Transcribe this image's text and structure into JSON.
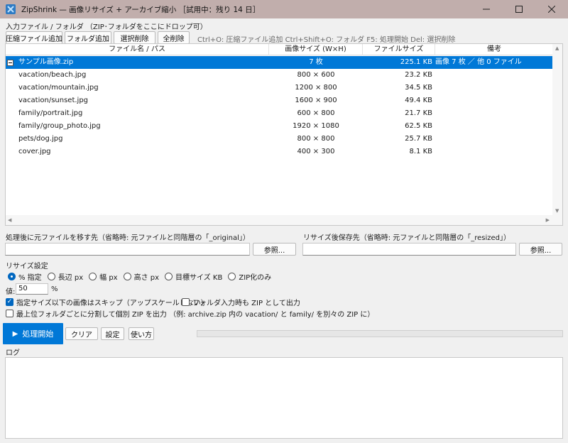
{
  "window": {
    "title": "ZipShrink  —  画像リサイズ + アーカイブ縮小  ［試用中：残り 14 日］",
    "controls": {
      "minimize": "–",
      "maximize": "□",
      "close": "✕"
    }
  },
  "input_section": {
    "label": "入力ファイル / フォルダ （ZIP･フォルダをここにドロップ可）",
    "buttons": {
      "add_archive": "圧縮ファイル追加",
      "add_folder": "フォルダ追加",
      "remove_selected": "選択削除",
      "remove_all": "全削除"
    },
    "shortcuts_hint": "Ctrl+O: 圧縮ファイル追加  Ctrl+Shift+O: フォルダ  F5: 処理開始  Del: 選択削除"
  },
  "file_table": {
    "columns": {
      "name": "ファイル名 / パス",
      "dimensions": "画像サイズ (W×H)",
      "filesize": "ファイルサイズ",
      "note": "備考"
    },
    "rows": [
      {
        "name": "サンプル画像.zip",
        "dimensions": "7 枚",
        "filesize": "225.1 KB",
        "note": "画像 7 枚 ／ 他 0 ファイル"
      },
      {
        "name": "vacation/beach.jpg",
        "dimensions": "800 × 600",
        "filesize": "23.2 KB",
        "note": ""
      },
      {
        "name": "vacation/mountain.jpg",
        "dimensions": "1200 × 800",
        "filesize": "34.5 KB",
        "note": ""
      },
      {
        "name": "vacation/sunset.jpg",
        "dimensions": "1600 × 900",
        "filesize": "49.4 KB",
        "note": ""
      },
      {
        "name": "family/portrait.jpg",
        "dimensions": "600 × 800",
        "filesize": "21.7 KB",
        "note": ""
      },
      {
        "name": "family/group_photo.jpg",
        "dimensions": "1920 × 1080",
        "filesize": "62.5 KB",
        "note": ""
      },
      {
        "name": "pets/dog.jpg",
        "dimensions": "800 × 800",
        "filesize": "25.7 KB",
        "note": ""
      },
      {
        "name": "cover.jpg",
        "dimensions": "400 × 300",
        "filesize": "8.1 KB",
        "note": ""
      }
    ]
  },
  "move_original": {
    "label": "処理後に元ファイルを移す先（省略時: 元ファイルと同階層の「_original」）",
    "value": "",
    "browse": "参照..."
  },
  "resized_dest": {
    "label": "リサイズ後保存先（省略時: 元ファイルと同階層の「_resized」）",
    "value": "",
    "browse": "参照..."
  },
  "resize_settings": {
    "label": "リサイズ設定",
    "modes": [
      {
        "label": "% 指定",
        "selected": true
      },
      {
        "label": "長辺 px",
        "selected": false
      },
      {
        "label": "幅 px",
        "selected": false
      },
      {
        "label": "高さ px",
        "selected": false
      },
      {
        "label": "目標サイズ KB",
        "selected": false
      },
      {
        "label": "ZIP化のみ",
        "selected": false
      }
    ],
    "value_label": "値:",
    "value": "50",
    "value_unit": "%",
    "skip_small": {
      "label": "指定サイズ以下の画像はスキップ（アップスケールしない）",
      "checked": true
    },
    "folder_zip": {
      "label": "フォルダ入力時も ZIP として出力",
      "checked": false
    },
    "split_zip": {
      "label": "最上位フォルダごとに分割して個別 ZIP を出力 （例: archive.zip 内の vacation/ と family/ を別々の ZIP に）",
      "checked": false
    }
  },
  "actions": {
    "start": "処理開始",
    "clear": "クリア",
    "settings": "設定",
    "help": "使い方",
    "progress": 0
  },
  "log": {
    "label": "ログ",
    "content": ""
  },
  "colors": {
    "accent": "#0078d7",
    "titlebar": "#c1aeac",
    "selection": "#0078d7"
  }
}
